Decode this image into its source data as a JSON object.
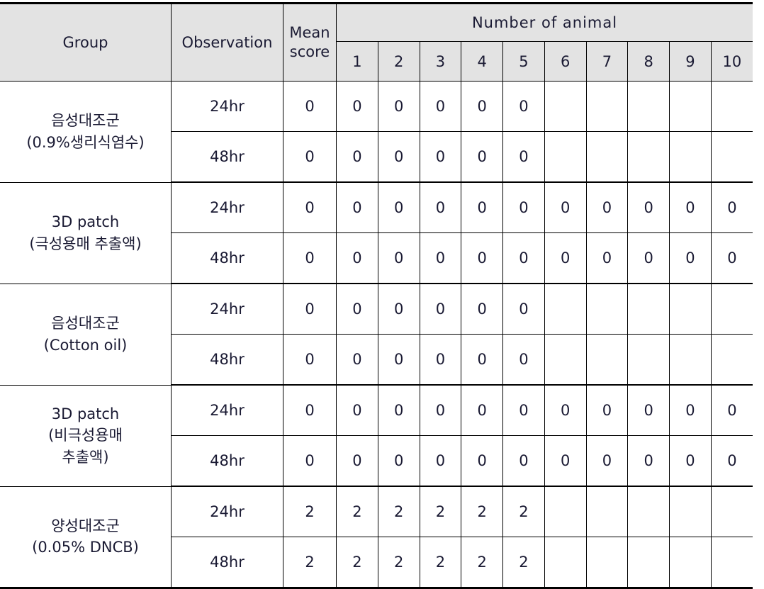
{
  "table": {
    "headers": {
      "group": "Group",
      "observation": "Observation",
      "mean_score_line1": "Mean",
      "mean_score_line2": "score",
      "number_of_animal": "Number of animal",
      "animal_numbers": [
        "1",
        "2",
        "3",
        "4",
        "5",
        "6",
        "7",
        "8",
        "9",
        "10"
      ]
    },
    "colors": {
      "header_background": "#e3e3e3",
      "border": "#000000",
      "text": "#1a1a33",
      "cell_background": "#ffffff"
    },
    "groups": [
      {
        "name_lines": [
          "음성대조군",
          "(0.9%생리식염수)"
        ],
        "rows": [
          {
            "observation": "24hr",
            "mean_score": "0",
            "animals": [
              "0",
              "0",
              "0",
              "0",
              "0",
              "",
              "",
              "",
              "",
              ""
            ]
          },
          {
            "observation": "48hr",
            "mean_score": "0",
            "animals": [
              "0",
              "0",
              "0",
              "0",
              "0",
              "",
              "",
              "",
              "",
              ""
            ]
          }
        ]
      },
      {
        "name_lines": [
          "3D patch",
          "(극성용매 추출액)"
        ],
        "rows": [
          {
            "observation": "24hr",
            "mean_score": "0",
            "animals": [
              "0",
              "0",
              "0",
              "0",
              "0",
              "0",
              "0",
              "0",
              "0",
              "0"
            ]
          },
          {
            "observation": "48hr",
            "mean_score": "0",
            "animals": [
              "0",
              "0",
              "0",
              "0",
              "0",
              "0",
              "0",
              "0",
              "0",
              "0"
            ]
          }
        ]
      },
      {
        "name_lines": [
          "음성대조군",
          "(Cotton oil)"
        ],
        "rows": [
          {
            "observation": "24hr",
            "mean_score": "0",
            "animals": [
              "0",
              "0",
              "0",
              "0",
              "0",
              "",
              "",
              "",
              "",
              ""
            ]
          },
          {
            "observation": "48hr",
            "mean_score": "0",
            "animals": [
              "0",
              "0",
              "0",
              "0",
              "0",
              "",
              "",
              "",
              "",
              ""
            ]
          }
        ]
      },
      {
        "name_lines": [
          "3D patch",
          "(비극성용매",
          "추출액)"
        ],
        "rows": [
          {
            "observation": "24hr",
            "mean_score": "0",
            "animals": [
              "0",
              "0",
              "0",
              "0",
              "0",
              "0",
              "0",
              "0",
              "0",
              "0"
            ]
          },
          {
            "observation": "48hr",
            "mean_score": "0",
            "animals": [
              "0",
              "0",
              "0",
              "0",
              "0",
              "0",
              "0",
              "0",
              "0",
              "0"
            ]
          }
        ]
      },
      {
        "name_lines": [
          "양성대조군",
          "(0.05% DNCB)"
        ],
        "rows": [
          {
            "observation": "24hr",
            "mean_score": "2",
            "animals": [
              "2",
              "2",
              "2",
              "2",
              "2",
              "",
              "",
              "",
              "",
              ""
            ]
          },
          {
            "observation": "48hr",
            "mean_score": "2",
            "animals": [
              "2",
              "2",
              "2",
              "2",
              "2",
              "",
              "",
              "",
              "",
              ""
            ]
          }
        ]
      }
    ]
  }
}
